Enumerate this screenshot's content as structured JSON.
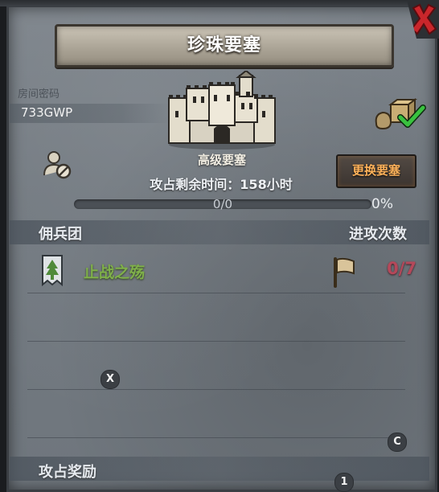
{
  "header": {
    "title": "珍珠要塞"
  },
  "room": {
    "password_label": "房间密码",
    "password_value": "733GWP"
  },
  "fortress": {
    "name": "高级要塞",
    "time_left": "攻占剩余时间：158小时",
    "change_button": "更换要塞"
  },
  "progress": {
    "text": "0/0",
    "percent_text": "0%",
    "fraction": 0
  },
  "table": {
    "col_guild": "佣兵团",
    "col_attacks": "进攻次数",
    "rows": [
      {
        "guild": "止战之殇",
        "attacks": "0/7"
      }
    ]
  },
  "rewards": {
    "title": "攻占奖励"
  },
  "badges": {
    "x": "X",
    "c": "C",
    "one": "1"
  },
  "icons": {
    "close": "close-x-icon",
    "castle": "castle-icon",
    "user": "user-block-icon",
    "supply": "supply-check-icon",
    "guild_flag": "guild-tree-banner-icon",
    "attack_flag": "attack-flag-icon"
  },
  "colors": {
    "guild_name": "#7fb04a",
    "attack_count": "#b5485a",
    "change_button_text": "#ffb25a",
    "close": "#c9262b"
  }
}
